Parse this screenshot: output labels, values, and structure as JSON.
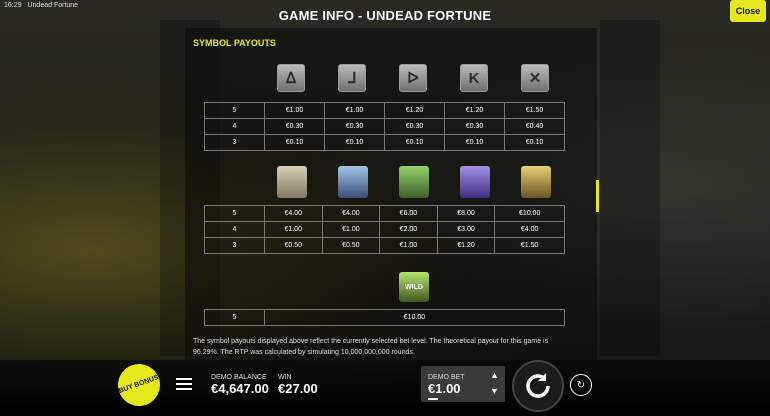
{
  "status_bar": {
    "time": "16:29",
    "app_name": "Undead Fortune"
  },
  "header": {
    "title": "GAME INFO - UNDEAD FORTUNE",
    "close_label": "Close"
  },
  "section": {
    "title": "SYMBOL PAYOUTS"
  },
  "low_symbols": {
    "icons": [
      "a-rune-icon",
      "j-rune-icon",
      "q-rune-icon",
      "k-rune-icon",
      "x-rune-icon"
    ],
    "glyphs": [
      "ᐃ",
      "ᒧ",
      "ᐅ",
      "K",
      "✕"
    ],
    "rows": [
      {
        "count": "5",
        "values": [
          "€1.00",
          "€1.00",
          "€1.20",
          "€1.20",
          "€1.50"
        ]
      },
      {
        "count": "4",
        "values": [
          "€0.30",
          "€0.30",
          "€0.30",
          "€0.30",
          "€0.40"
        ]
      },
      {
        "count": "3",
        "values": [
          "€0.10",
          "€0.10",
          "€0.10",
          "€0.10",
          "€0.10"
        ]
      }
    ]
  },
  "high_symbols": {
    "icons": [
      "mummy-icon",
      "jackal-icon",
      "snake-icon",
      "anubis-icon",
      "cleopatra-icon"
    ],
    "rows": [
      {
        "count": "5",
        "values": [
          "€4.00",
          "€4.00",
          "€6.00",
          "€8.00",
          "€10.00"
        ]
      },
      {
        "count": "4",
        "values": [
          "€1.00",
          "€1.00",
          "€2.00",
          "€3.00",
          "€4.00"
        ]
      },
      {
        "count": "3",
        "values": [
          "€0.50",
          "€0.50",
          "€1.00",
          "€1.20",
          "€1.50"
        ]
      }
    ]
  },
  "wild_symbol": {
    "icon": "wild-icon",
    "label": "WILD",
    "rows": [
      {
        "count": "5",
        "value": "€10.00"
      }
    ]
  },
  "info_text": "The symbol payouts displayed above reflect the currently selected bet level. The theoretical payout for this game is 96.29%. The RTP was calculated by simulating 10,000,000,000 rounds.",
  "bottom_bar": {
    "buy_bonus_label": "BUY BONUS",
    "balance_label": "DEMO BALANCE",
    "balance_value": "€4,647.00",
    "win_label": "WIN",
    "win_value": "€27.00",
    "bet_label": "DEMO BET",
    "bet_value": "€1.00"
  },
  "colors": {
    "accent": "#e6ea1c",
    "background": "#1b1c16"
  }
}
